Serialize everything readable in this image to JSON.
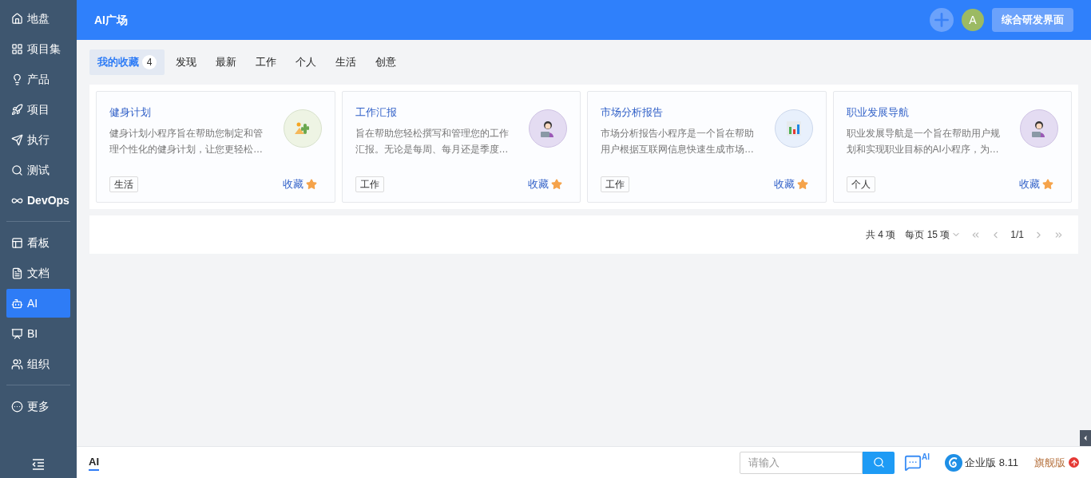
{
  "sidebar": {
    "groups": [
      [
        {
          "label": "地盘",
          "selected": false
        },
        {
          "label": "项目集",
          "selected": false
        },
        {
          "label": "产品",
          "selected": false
        },
        {
          "label": "项目",
          "selected": false
        },
        {
          "label": "执行",
          "selected": false
        },
        {
          "label": "测试",
          "selected": false
        },
        {
          "label": "DevOps",
          "selected": false
        }
      ],
      [
        {
          "label": "看板",
          "selected": false
        },
        {
          "label": "文档",
          "selected": false
        },
        {
          "label": "AI",
          "selected": true
        },
        {
          "label": "BI",
          "selected": false
        },
        {
          "label": "组织",
          "selected": false
        }
      ],
      [
        {
          "label": "更多",
          "selected": false
        }
      ]
    ]
  },
  "header": {
    "title": "AI广场",
    "avatar": "A",
    "button": "综合研发界面"
  },
  "tabs": [
    {
      "label": "我的收藏",
      "count": "4",
      "selected": true
    },
    {
      "label": "发现",
      "selected": false
    },
    {
      "label": "最新",
      "selected": false
    },
    {
      "label": "工作",
      "selected": false
    },
    {
      "label": "个人",
      "selected": false
    },
    {
      "label": "生活",
      "selected": false
    },
    {
      "label": "创意",
      "selected": false
    }
  ],
  "cards": [
    {
      "title": "健身计划",
      "description": "健身计划小程序旨在帮助您制定和管理个性化的健身计划，让您更轻松…",
      "tag": "生活",
      "action": "收藏",
      "kind": "cactus"
    },
    {
      "title": "工作汇报",
      "description": "旨在帮助您轻松撰写和管理您的工作汇报。无论是每周、每月还是季度…",
      "tag": "工作",
      "action": "收藏",
      "kind": "person"
    },
    {
      "title": "市场分析报告",
      "description": "市场分析报告小程序是一个旨在帮助用户根据互联网信息快速生成市场…",
      "tag": "工作",
      "action": "收藏",
      "kind": "chart"
    },
    {
      "title": "职业发展导航",
      "description": "职业发展导航是一个旨在帮助用户规划和实现职业目标的AI小程序，为…",
      "tag": "个人",
      "action": "收藏",
      "kind": "person"
    }
  ],
  "pagination": {
    "total": "共 4 项",
    "page_size": "每页 15 项",
    "page": "1/1"
  },
  "footer": {
    "tab": "AI",
    "search_placeholder": "请输入",
    "chat_badge": "AI",
    "edition": "企业版 8.11",
    "upgrade": "旗舰版"
  }
}
